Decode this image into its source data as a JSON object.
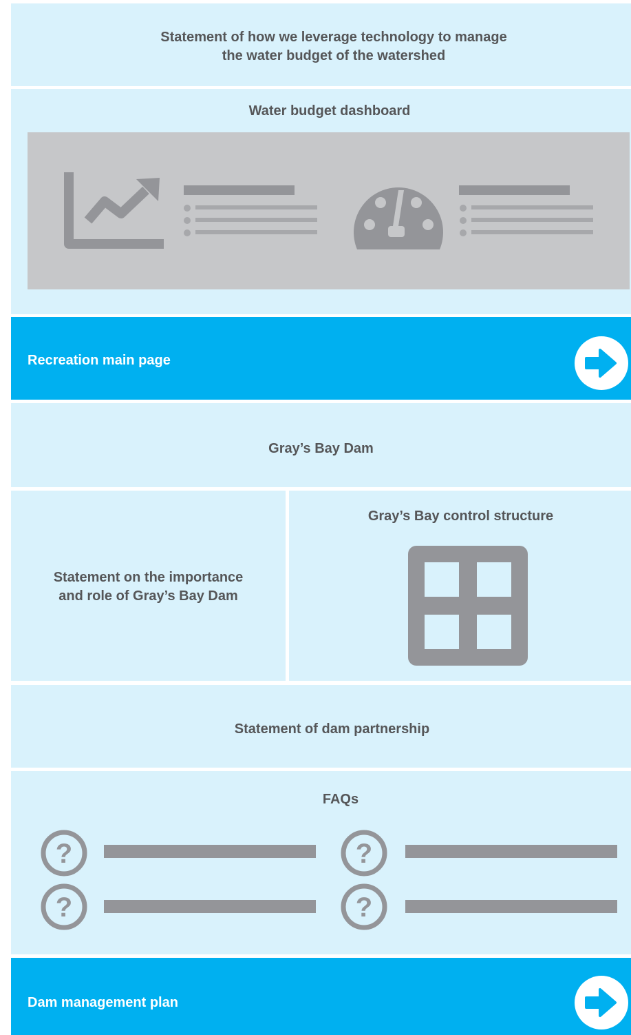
{
  "technology_statement": {
    "line1": "Statement of how we leverage technology to manage",
    "line2": "the water budget of the watershed"
  },
  "dashboard": {
    "title": "Water budget dashboard",
    "icons": [
      "trend-chart-icon",
      "gauge-icon"
    ]
  },
  "recreation_link": {
    "label": "Recreation main page",
    "icon": "arrow-right-icon"
  },
  "dam_header": {
    "title": "Gray’s Bay Dam"
  },
  "importance_statement": {
    "line1": "Statement on the importance",
    "line2": "and role of Gray’s Bay Dam"
  },
  "control_structure": {
    "title": "Gray’s Bay control structure",
    "icon": "grid-icon"
  },
  "partnership": {
    "text": "Statement of dam partnership"
  },
  "faqs": {
    "title": "FAQs",
    "item_icon": "question-icon",
    "item_count": 4
  },
  "dam_plan_link": {
    "label": "Dam management plan",
    "icon": "arrow-right-icon"
  },
  "colors": {
    "panel_bg": "#d9f2fc",
    "accent_blue": "#00b0f0",
    "placeholder_gray": "#949599",
    "dashboard_bg": "#c6c7c9",
    "text": "#555658"
  }
}
